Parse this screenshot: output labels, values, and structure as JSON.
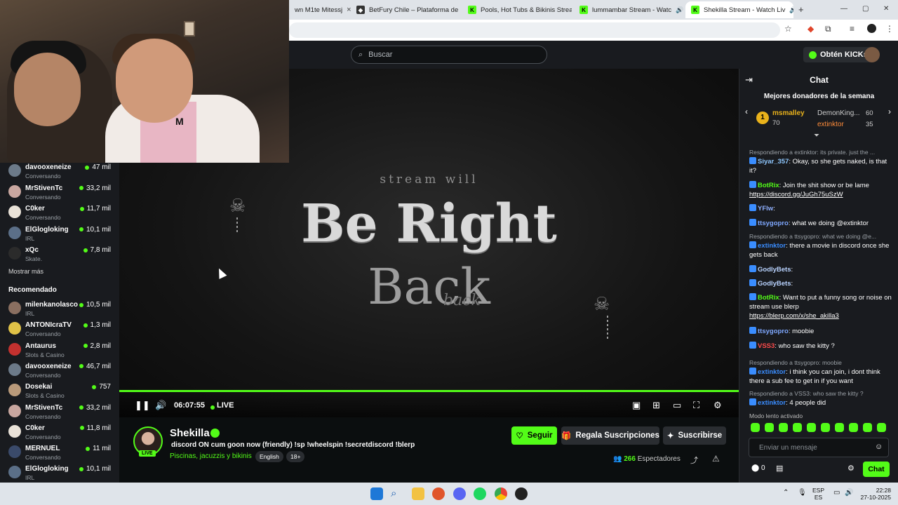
{
  "browser": {
    "tabs": [
      {
        "label": "wn M1te Mitessj",
        "close": "×"
      },
      {
        "label": "BetFury Chile – Plataforma de c",
        "close": "×"
      },
      {
        "label": "Pools, Hot Tubs & Bikinis Strea",
        "close": "×"
      },
      {
        "label": "lummambar Stream - Watc",
        "close": "×"
      },
      {
        "label": "Shekilla Stream - Watch Liv",
        "close": "×"
      }
    ],
    "new_tab": "+",
    "win_min": "—",
    "win_max": "▢",
    "win_close": "✕"
  },
  "header": {
    "search_placeholder": "Buscar",
    "kicks_button": "Obtén KICKs"
  },
  "sidebar": {
    "following": [
      {
        "name": "davooxeneize",
        "category": "Conversando",
        "viewers": "47 mil",
        "color": "#6c7a89"
      },
      {
        "name": "MrStivenTc",
        "category": "Conversando",
        "viewers": "33,2 mil",
        "color": "#c9a7a0"
      },
      {
        "name": "C0ker",
        "category": "Conversando",
        "viewers": "11,7 mil",
        "color": "#e9e2d8"
      },
      {
        "name": "ElGlogloking",
        "category": "IRL",
        "viewers": "10,1 mil",
        "color": "#5b6f88"
      },
      {
        "name": "xQc",
        "category": "Skate.",
        "viewers": "7,8 mil",
        "color": "#2b2b2b"
      }
    ],
    "show_more": "Mostrar más",
    "recommended_title": "Recomendado",
    "recommended": [
      {
        "name": "milenkanolasco",
        "category": "IRL",
        "viewers": "10,5 mil",
        "color": "#8a6f60"
      },
      {
        "name": "ANTONIcraTV",
        "category": "Conversando",
        "viewers": "1,3 mil",
        "color": "#e0c247"
      },
      {
        "name": "Antaurus",
        "category": "Slots & Casino",
        "viewers": "2,8 mil",
        "color": "#c3312f"
      },
      {
        "name": "davooxeneize",
        "category": "Conversando",
        "viewers": "46,7 mil",
        "color": "#6c7a89"
      },
      {
        "name": "Dosekai",
        "category": "Slots & Casino",
        "viewers": "757",
        "color": "#b99a7a"
      },
      {
        "name": "MrStivenTc",
        "category": "Conversando",
        "viewers": "33,2 mil",
        "color": "#c9a7a0"
      },
      {
        "name": "C0ker",
        "category": "Conversando",
        "viewers": "11,8 mil",
        "color": "#e9e2d8"
      },
      {
        "name": "MERNUEL",
        "category": "Conversando",
        "viewers": "11 mil",
        "color": "#3a4a6a"
      },
      {
        "name": "ElGlogloking",
        "category": "IRL",
        "viewers": "10,1 mil",
        "color": "#5b6f88"
      }
    ]
  },
  "webcam": {
    "tag": "M"
  },
  "player": {
    "brb_small": "stream will",
    "brb_big": "Be Right",
    "brb_back": "Back",
    "brb_script": "back",
    "time": "06:07:55",
    "live": "LIVE",
    "progress_fraction": 1.0
  },
  "channel": {
    "name": "Shekilla",
    "live_badge": "LIVE",
    "title": "discord ON cum goon now  (friendly)  !sp  !wheelspin !secretdiscord !blerp",
    "category": "Piscinas, jacuzzis y bikinis",
    "tags": [
      "English",
      "18+"
    ],
    "follow_button": "Seguir",
    "gift_button": "Regala Suscripciones",
    "subscribe_button": "Suscribirse",
    "viewers_count": "266",
    "viewers_label": "Espectadores"
  },
  "chat": {
    "title": "Chat",
    "donors_title": "Mejores donadores de la semana",
    "donors": [
      {
        "rank": "1",
        "name": "msmalley",
        "amount": "70"
      },
      {
        "name": "DemonKing...",
        "amount": "60"
      },
      {
        "name": "extinktor",
        "amount": "35"
      }
    ],
    "messages": [
      {
        "reply": "Respondiendo a extinktor: its private. just the ...",
        "user": "Siyar_357",
        "user_color": "#8fc8ff",
        "text": ": Okay, so she gets naked, is that it?"
      },
      {
        "user": "BotRix",
        "user_color": "#53fc18",
        "text": ": Join the shit show or be lame ",
        "link": "https://discord.gg/JuGh75uSzW"
      },
      {
        "user": "YFlw",
        "user_color": "#8fb0ff",
        "text": ":"
      },
      {
        "user": "ttsygopro",
        "user_color": "#7fa8ff",
        "text": ": what we doing @extinktor"
      },
      {
        "reply": "Respondiendo a ttsygopro: what we doing @e...",
        "user": "extinktor",
        "user_color": "#3a8dff",
        "text": ": there a movie in discord once she gets back"
      },
      {
        "user": "GodlyBets",
        "user_color": "#b9d3ff",
        "text": ":"
      },
      {
        "user": "GodlyBets",
        "user_color": "#b9d3ff",
        "text": ":"
      },
      {
        "user": "BotRix",
        "user_color": "#53fc18",
        "text": ": Want to put a funny song or noise on stream use blerp ",
        "link": "https://blerp.com/x/she_akilla3"
      },
      {
        "user": "ttsygopro",
        "user_color": "#7fa8ff",
        "text": ": moobie"
      },
      {
        "user": "VSS3",
        "user_color": "#ff4b4b",
        "text": ": who saw the kitty ?"
      },
      {
        "reply": "Respondiendo a ttsygopro: moobie",
        "user": "extinktor",
        "user_color": "#3a8dff",
        "text": ": i think you can join, i dont think there a sub fee to get in if you want"
      },
      {
        "reply": "Respondiendo a VSS3: who saw the kitty ?",
        "user": "extinktor",
        "user_color": "#3a8dff",
        "text": ": 4 people did"
      }
    ],
    "slow_mode": "Modo lento activado",
    "input_placeholder": "Enviar un mensaje",
    "points": "0",
    "chat_button": "Chat"
  },
  "taskbar": {
    "lang_top": "ESP",
    "lang_bottom": "ES",
    "time": "22:28",
    "date": "27-10-2025"
  }
}
